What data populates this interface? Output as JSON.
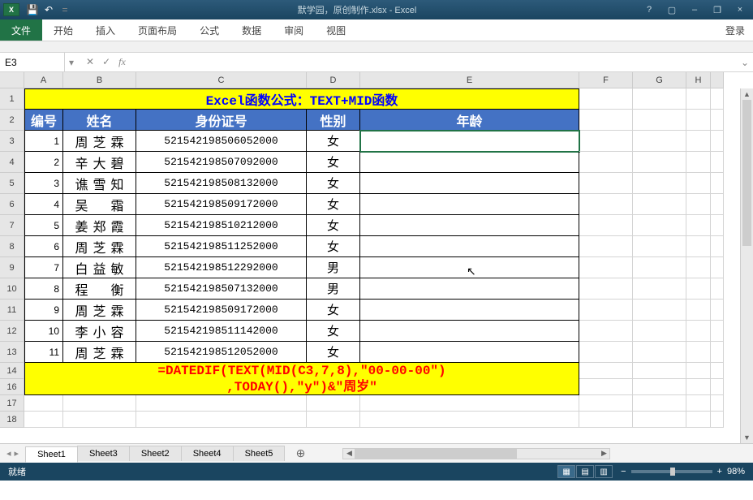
{
  "window": {
    "title": "默学园，原创制作.xlsx - Excel"
  },
  "qat": {
    "save": "💾",
    "undo": "↶",
    "redo": "↷"
  },
  "winbtns": {
    "help": "?",
    "ribbon": "▢",
    "min": "–",
    "restore": "❐",
    "close": "×"
  },
  "tabs": {
    "file": "文件",
    "home": "开始",
    "insert": "插入",
    "layout": "页面布局",
    "formulas": "公式",
    "data": "数据",
    "review": "审阅",
    "view": "视图",
    "login": "登录"
  },
  "namebox": "E3",
  "fbar": {
    "cancel": "✕",
    "enter": "✓",
    "fx": "fx"
  },
  "columns": [
    "A",
    "B",
    "C",
    "D",
    "E",
    "F",
    "G",
    "H"
  ],
  "title_formula": "Excel函数公式：TEXT+MID函数",
  "headers": {
    "id": "编号",
    "name": "姓名",
    "cardno": "身份证号",
    "gender": "性别",
    "age": "年龄"
  },
  "rows": [
    {
      "n": "1",
      "name": "周芝霖",
      "card": "521542198506052000",
      "g": "女"
    },
    {
      "n": "2",
      "name": "辛大碧",
      "card": "521542198507092000",
      "g": "女"
    },
    {
      "n": "3",
      "name": "谯雪知",
      "card": "521542198508132000",
      "g": "女"
    },
    {
      "n": "4",
      "name": "吴　霜",
      "card": "521542198509172000",
      "g": "女"
    },
    {
      "n": "5",
      "name": "姜郑霞",
      "card": "521542198510212000",
      "g": "女"
    },
    {
      "n": "6",
      "name": "周芝霖",
      "card": "521542198511252000",
      "g": "女"
    },
    {
      "n": "7",
      "name": "白益敏",
      "card": "521542198512292000",
      "g": "男"
    },
    {
      "n": "8",
      "name": "程　衡",
      "card": "521542198507132000",
      "g": "男"
    },
    {
      "n": "9",
      "name": "周芝霖",
      "card": "521542198509172000",
      "g": "女"
    },
    {
      "n": "10",
      "name": "李小容",
      "card": "521542198511142000",
      "g": "女"
    },
    {
      "n": "11",
      "name": "周芝霖",
      "card": "521542198512052000",
      "g": "女"
    }
  ],
  "footer_formula_line1": "=DATEDIF(TEXT(MID(C3,7,8),\"00-00-00\")",
  "footer_formula_line2": ",TODAY(),\"y\")&\"周岁\"",
  "sheets": [
    "Sheet1",
    "Sheet3",
    "Sheet2",
    "Sheet4",
    "Sheet5"
  ],
  "status": {
    "ready": "就绪",
    "zoom": "98%"
  }
}
